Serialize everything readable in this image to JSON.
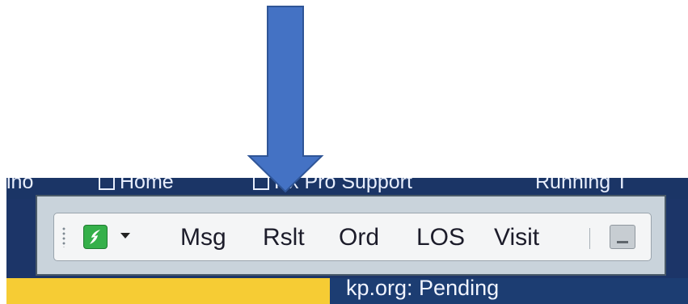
{
  "taskbar": {
    "items": [
      "ino",
      "Home",
      "Rx Pro Support",
      "Running T"
    ]
  },
  "toolbar": {
    "app_icon": "green-f-app-icon",
    "buttons": [
      "Msg",
      "Rslt",
      "Ord",
      "LOS",
      "Visit"
    ]
  },
  "status_bar": {
    "text": "kp.org: Pending"
  },
  "annotation": {
    "arrow_color": "#4472c4"
  }
}
